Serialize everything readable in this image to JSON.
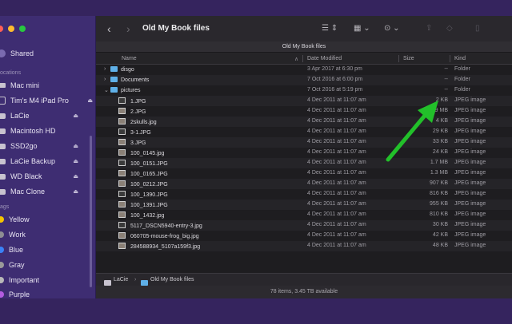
{
  "window": {
    "title": "Old My Book files"
  },
  "path_title": "Old My Book files",
  "sidebar": {
    "sections": {
      "locations": "ocations",
      "tags": "ags"
    },
    "items": [
      {
        "label": "Shared",
        "kind": "shared"
      },
      {
        "label": "Mac mini",
        "kind": "computer"
      },
      {
        "label": "Tim's M4 iPad Pro",
        "kind": "ipad"
      },
      {
        "label": "LaCie",
        "kind": "disk"
      },
      {
        "label": "Macintosh HD",
        "kind": "disk"
      },
      {
        "label": "SSD2go",
        "kind": "disk"
      },
      {
        "label": "LaCie Backup",
        "kind": "disk"
      },
      {
        "label": "WD Black",
        "kind": "disk"
      },
      {
        "label": "Mac Clone",
        "kind": "disk"
      }
    ],
    "tags": [
      {
        "label": "Yellow",
        "color": "#f5c400"
      },
      {
        "label": "Work",
        "color": "#8e8e93"
      },
      {
        "label": "Blue",
        "color": "#3a82f7"
      },
      {
        "label": "Gray",
        "color": "#9a9a9a"
      },
      {
        "label": "Important",
        "color": "#b8b8b8"
      },
      {
        "label": "Purple",
        "color": "#b35ce0"
      }
    ]
  },
  "toolbar": {
    "back": "‹",
    "forward": "›",
    "list_view": "☰ ⇕",
    "group": "▦ ⌄",
    "more": "⊙ ⌄",
    "share": "⇪",
    "tag": "◇",
    "trash": "▯"
  },
  "columns": {
    "name": "Name",
    "date": "Date Modified",
    "size": "Size",
    "kind": "Kind"
  },
  "rows": [
    {
      "type": "folder",
      "chev": "›",
      "name": "disgo",
      "date": "3 Apr 2017 at 6:30 pm",
      "size": "--",
      "kind": "Folder"
    },
    {
      "type": "folder",
      "chev": "›",
      "name": "Documents",
      "date": "7 Oct 2016 at 6:00 pm",
      "size": "--",
      "kind": "Folder"
    },
    {
      "type": "folder",
      "chev": "⌄",
      "name": "pictures",
      "date": "7 Oct 2016 at 5:19 pm",
      "size": "--",
      "kind": "Folder"
    },
    {
      "type": "image",
      "name": "1.JPG",
      "date": "4 Dec 2011 at 11:07 am",
      "size": "2 KB",
      "kind": "JPEG image"
    },
    {
      "type": "image",
      "name": "2.JPG",
      "date": "4 Dec 2011 at 11:07 am",
      "size": "9 MB",
      "kind": "JPEG image"
    },
    {
      "type": "image",
      "name": "2skulls.jpg",
      "date": "4 Dec 2011 at 11:07 am",
      "size": "4 KB",
      "kind": "JPEG image"
    },
    {
      "type": "image",
      "name": "3-1.JPG",
      "date": "4 Dec 2011 at 11:07 am",
      "size": "29 KB",
      "kind": "JPEG image"
    },
    {
      "type": "image",
      "name": "3.JPG",
      "date": "4 Dec 2011 at 11:07 am",
      "size": "33 KB",
      "kind": "JPEG image"
    },
    {
      "type": "image",
      "name": "100_0145.jpg",
      "date": "4 Dec 2011 at 11:07 am",
      "size": "24 KB",
      "kind": "JPEG image"
    },
    {
      "type": "image",
      "name": "100_0151.JPG",
      "date": "4 Dec 2011 at 11:07 am",
      "size": "1.7 MB",
      "kind": "JPEG image"
    },
    {
      "type": "image",
      "name": "100_0165.JPG",
      "date": "4 Dec 2011 at 11:07 am",
      "size": "1.3 MB",
      "kind": "JPEG image"
    },
    {
      "type": "image",
      "name": "100_0212.JPG",
      "date": "4 Dec 2011 at 11:07 am",
      "size": "907 KB",
      "kind": "JPEG image"
    },
    {
      "type": "image",
      "name": "100_1390.JPG",
      "date": "4 Dec 2011 at 11:07 am",
      "size": "816 KB",
      "kind": "JPEG image"
    },
    {
      "type": "image",
      "name": "100_1391.JPG",
      "date": "4 Dec 2011 at 11:07 am",
      "size": "955 KB",
      "kind": "JPEG image"
    },
    {
      "type": "image",
      "name": "100_1432.jpg",
      "date": "4 Dec 2011 at 11:07 am",
      "size": "810 KB",
      "kind": "JPEG image"
    },
    {
      "type": "image",
      "name": "5117_DSCN5940-entry-3.jpg",
      "date": "4 Dec 2011 at 11:07 am",
      "size": "30 KB",
      "kind": "JPEG image"
    },
    {
      "type": "image",
      "name": "060705-mouse-frog_big.jpg",
      "date": "4 Dec 2011 at 11:07 am",
      "size": "42 KB",
      "kind": "JPEG image"
    },
    {
      "type": "image",
      "name": "284588934_5107a159f3.jpg",
      "date": "4 Dec 2011 at 11:07 am",
      "size": "48 KB",
      "kind": "JPEG image"
    }
  ],
  "pathbar": {
    "root": "LaCie",
    "sep": "›",
    "folder": "Old My Book files"
  },
  "status": "78 items, 3.45 TB available",
  "colors": {
    "sidebar": "#3e2d72",
    "main": "#1e1d20",
    "folder": "#5fb0e8",
    "arrow": "#22c02a"
  }
}
